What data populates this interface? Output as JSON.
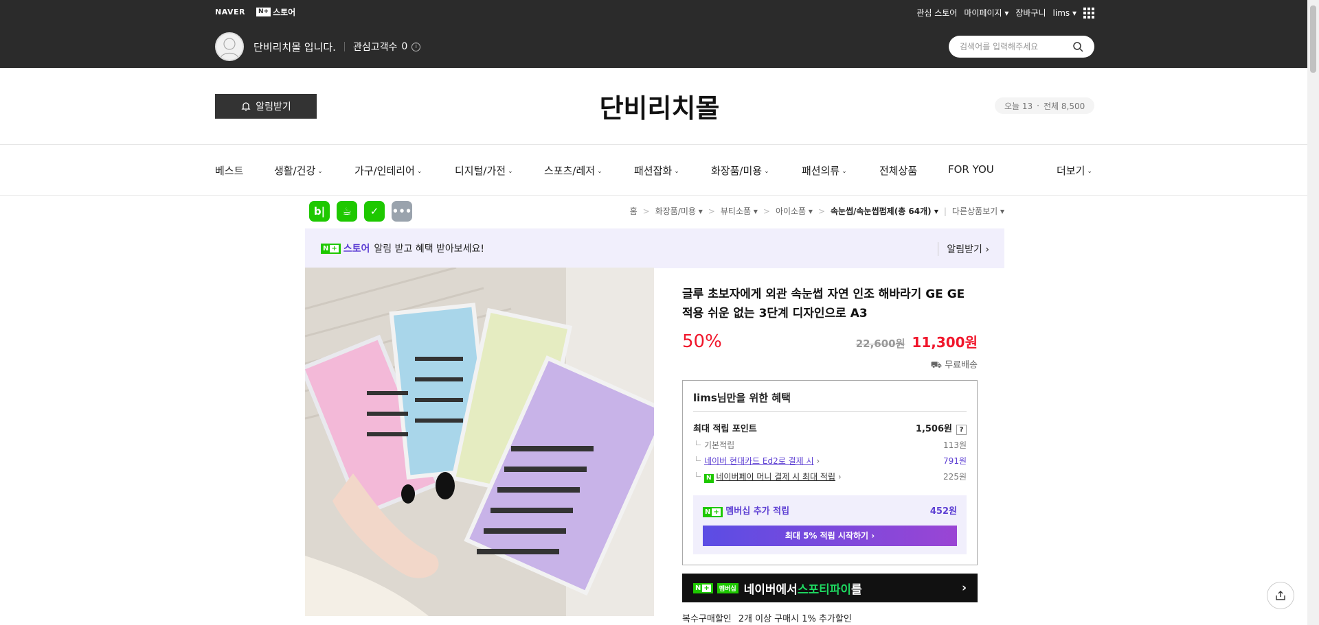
{
  "gnb": {
    "naver": "NAVER",
    "nplus_store": "스토어",
    "nplus_badge": "N+",
    "links": [
      "관심 스토어",
      "마이페이지",
      "장바구니",
      "lims"
    ]
  },
  "store": {
    "name": "단비리치몰 입니다.",
    "fav_label": "관심고객수",
    "fav_count": "0",
    "search_placeholder": "검색어를 입력해주세요",
    "title": "단비리치몰",
    "alarm": "알림받기",
    "visitor_today": "오늘 13",
    "visitor_total": "전체 8,500"
  },
  "nav": [
    "베스트",
    "생활/건강",
    "가구/인테리어",
    "디지털/가전",
    "스포츠/레저",
    "패션잡화",
    "화장품/미용",
    "패션의류",
    "전체상품",
    "FOR YOU",
    "더보기"
  ],
  "breadcrumb": [
    "홈",
    "화장품/미용",
    "뷰티소품",
    "아이소품",
    "속눈썹/속눈썹펌제(총 64개)",
    "다른상품보기"
  ],
  "promo": {
    "store": "스토어",
    "text": "알림 받고 혜택 받아보세요!",
    "cta": "알림받기"
  },
  "product": {
    "title": "글루 초보자에게 외관 속눈썹 자연 인조 해바라기 GE GE 적용 쉬운 없는 3단계 디자인으로 A3",
    "discount": "50%",
    "original_price": "22,600원",
    "sale_price": "11,300원",
    "shipping": "무료배송"
  },
  "benefit": {
    "title": "lims님만을 위한 혜택",
    "max_point_label": "최대 적립 포인트",
    "max_point": "1,506원",
    "rows": [
      {
        "label": "기본적립",
        "value": "113원"
      },
      {
        "label": "네이버 현대카드 Ed2로 결제 시",
        "value": "791원"
      },
      {
        "label": "네이버페이 머니 결제 시 최대 적립",
        "value": "225원"
      }
    ],
    "member_label": "멤버십 추가 적립",
    "member_value": "452원",
    "member_cta": "최대 5% 적립 시작하기"
  },
  "spotify": {
    "prefix": "네이버에서 ",
    "brand": "스포티파이",
    "suffix": "를",
    "badge": "멤버십"
  },
  "bulk": {
    "label": "복수구매할인",
    "text": "2개 이상 구매시 1% 추가할인"
  },
  "colors": {
    "accent_red": "#f0162b",
    "naver_green": "#1ec800",
    "purple": "#5d3fd3"
  }
}
